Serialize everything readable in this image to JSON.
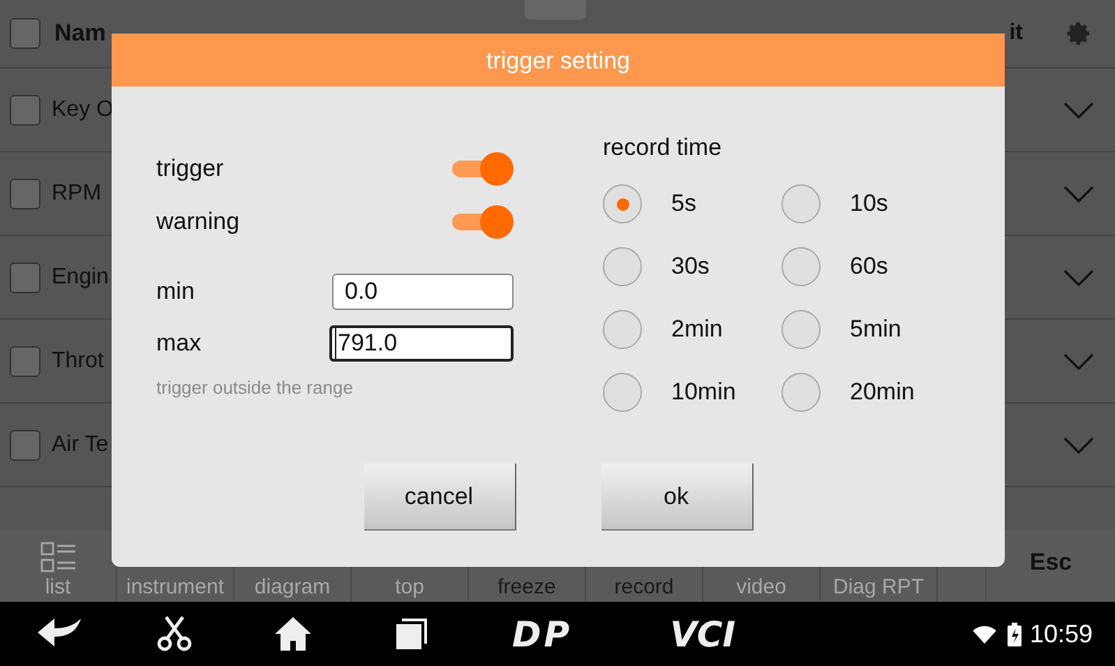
{
  "table": {
    "header": {
      "checked": false,
      "name": "Nam",
      "unit": "it"
    },
    "rows": [
      {
        "name": "Key O",
        "checked": false
      },
      {
        "name": "RPM",
        "checked": false
      },
      {
        "name": "Engin",
        "checked": false
      },
      {
        "name": "Throt",
        "checked": false
      },
      {
        "name": "Air Te",
        "checked": false
      }
    ]
  },
  "toolbar": [
    {
      "label": "list",
      "disabled": true
    },
    {
      "label": "instrument",
      "disabled": true
    },
    {
      "label": "diagram",
      "disabled": true
    },
    {
      "label": "top",
      "disabled": true
    },
    {
      "label": "freeze",
      "disabled": false
    },
    {
      "label": "record",
      "disabled": false
    },
    {
      "label": "video",
      "disabled": true
    },
    {
      "label": "Diag RPT",
      "disabled": true
    }
  ],
  "esc_button": "Esc",
  "dialog": {
    "title": "trigger setting",
    "toggles": [
      {
        "label": "trigger",
        "on": true
      },
      {
        "label": "warning",
        "on": true
      }
    ],
    "fields": [
      {
        "label": "min",
        "value": "0.0",
        "focused": false
      },
      {
        "label": "max",
        "value": "791.0",
        "focused": true
      }
    ],
    "hint": "trigger outside the range",
    "record_time": {
      "label": "record time",
      "options": [
        {
          "label": "5s",
          "selected": true
        },
        {
          "label": "10s",
          "selected": false
        },
        {
          "label": "30s",
          "selected": false
        },
        {
          "label": "60s",
          "selected": false
        },
        {
          "label": "2min",
          "selected": false
        },
        {
          "label": "5min",
          "selected": false
        },
        {
          "label": "10min",
          "selected": false
        },
        {
          "label": "20min",
          "selected": false
        }
      ]
    },
    "buttons": [
      "cancel",
      "ok"
    ]
  },
  "nav_bar": {
    "logos": [
      "DP",
      "VCI"
    ],
    "time": "10:59"
  }
}
